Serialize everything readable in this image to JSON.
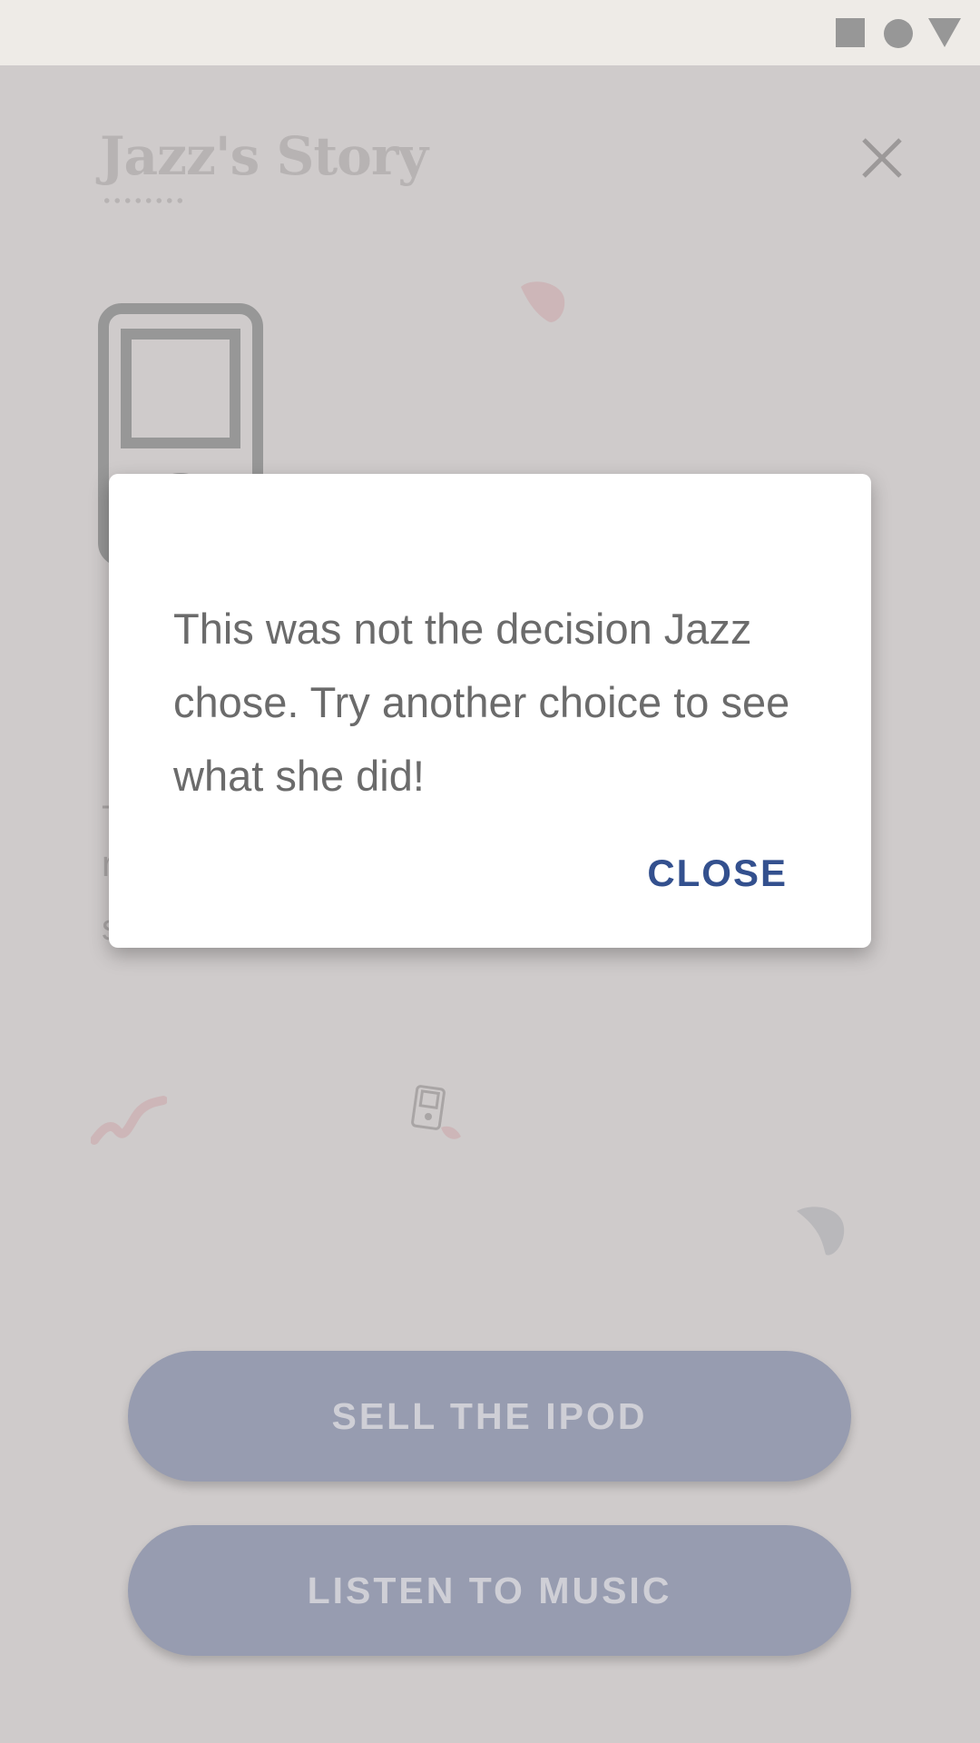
{
  "status_bar": {
    "icons": [
      "square-icon",
      "circle-icon",
      "triangle-icon"
    ]
  },
  "header": {
    "title": "Jazz's Story",
    "close_icon": "close-icon"
  },
  "choices": [
    {
      "label": "SELL THE IPOD"
    },
    {
      "label": "LISTEN TO MUSIC"
    }
  ],
  "dialog": {
    "message": "This was not the decision Jazz chose. Try another choice to see what she did!",
    "close_label": "CLOSE"
  },
  "colors": {
    "background": "#cfcbcb",
    "button": "#979cb0",
    "accent": "#33508e",
    "dialog_text": "#6b6b6b"
  }
}
